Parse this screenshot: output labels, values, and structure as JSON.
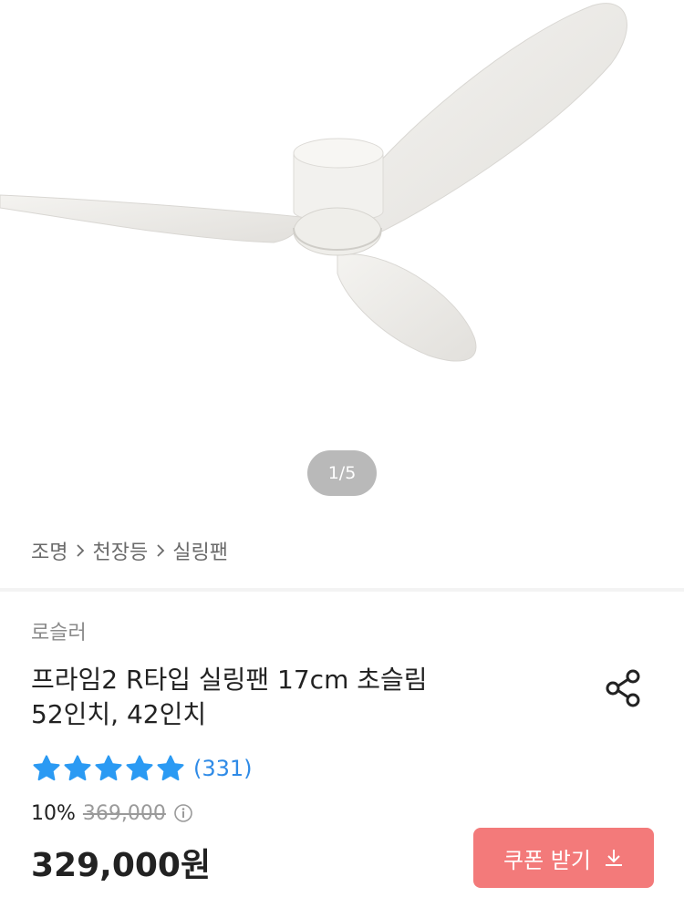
{
  "hero": {
    "pager": "1/5"
  },
  "breadcrumb": {
    "items": [
      "조명",
      "천장등",
      "실링팬"
    ]
  },
  "product": {
    "brand": "로슬러",
    "title_line1": "프라임2 R타입 실링팬 17cm 초슬림",
    "title_line2": "52인치, 42인치",
    "rating_stars": 5,
    "review_count": "(331)",
    "discount": "10%",
    "original_price": "369,000",
    "price": "329,000원",
    "coupon_label": "쿠폰 받기"
  },
  "colors": {
    "star": "#2b9af3",
    "coupon_bg": "#f37a7a",
    "review_link": "#2f8be7"
  },
  "icons": {
    "share": "share-icon",
    "info": "info-icon",
    "download": "download-icon",
    "chevron": "chevron-right-icon"
  }
}
